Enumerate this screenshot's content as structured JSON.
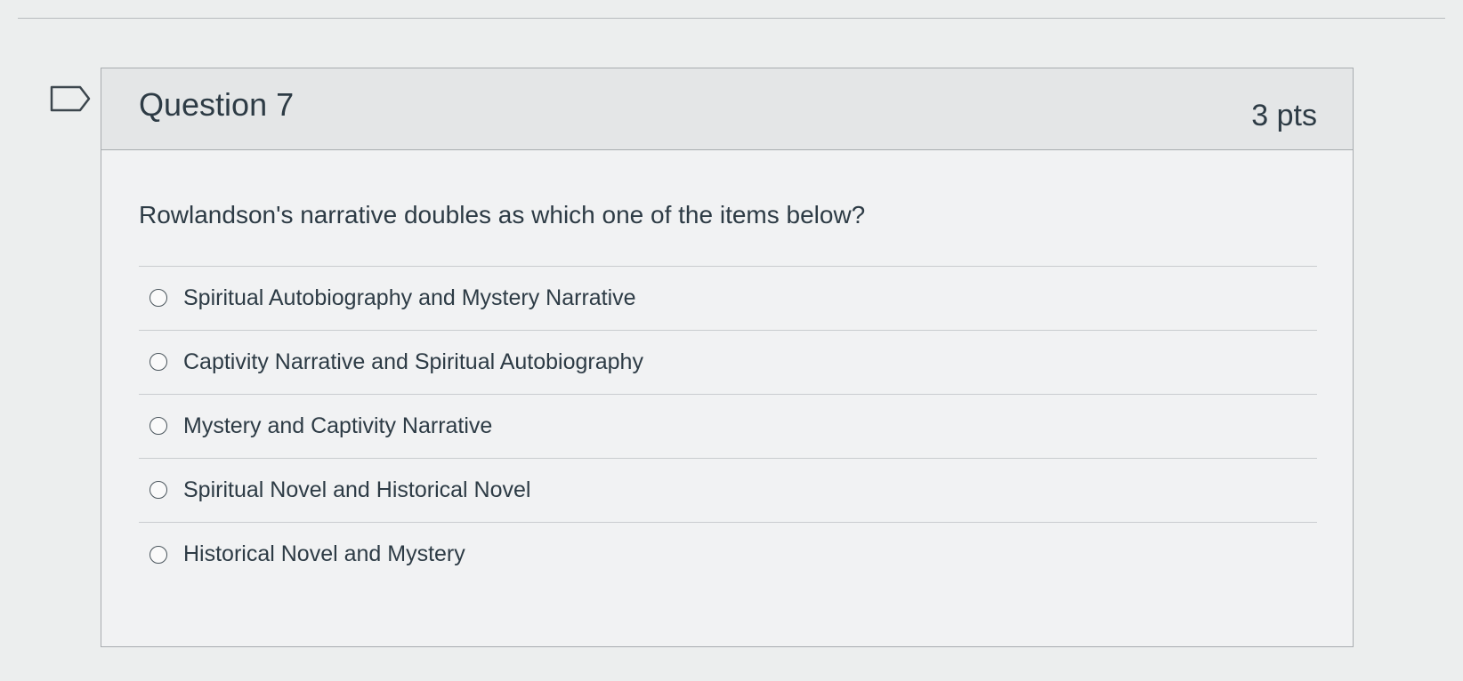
{
  "question": {
    "title": "Question 7",
    "points": "3 pts",
    "text": "Rowlandson's narrative doubles as which one of the items below?",
    "flag_icon": "flag-outline-icon"
  },
  "answers": [
    {
      "label": "Spiritual Autobiography and Mystery Narrative",
      "selected": false
    },
    {
      "label": "Captivity Narrative and Spiritual Autobiography",
      "selected": false
    },
    {
      "label": "Mystery and Captivity Narrative",
      "selected": false
    },
    {
      "label": "Spiritual Novel and Historical Novel",
      "selected": false
    },
    {
      "label": "Historical Novel and Mystery",
      "selected": false
    }
  ],
  "colors": {
    "background": "#eceeee",
    "header": "#e4e6e7",
    "border": "#a8acaf",
    "text": "#2d3b45"
  }
}
